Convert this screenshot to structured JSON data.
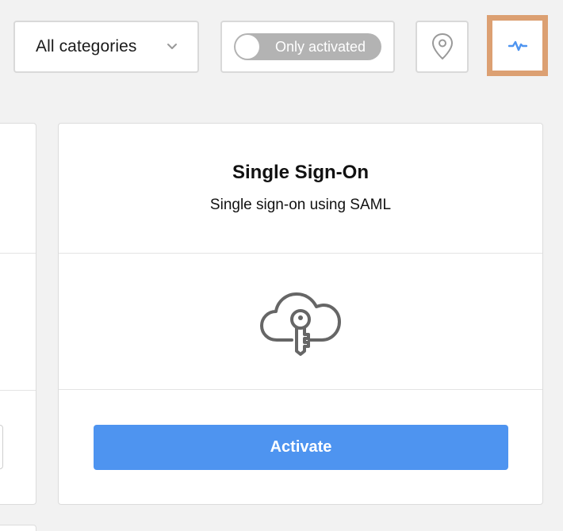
{
  "toolbar": {
    "category_select": {
      "value": "All categories"
    },
    "activation_toggle": {
      "label": "Only activated",
      "on": false
    },
    "location_button_icon": "map-pin-icon",
    "activity_button_icon": "activity-pulse-icon"
  },
  "card": {
    "title": "Single Sign-On",
    "subtitle": "Single sign-on using SAML",
    "icon": "cloud-key-icon",
    "action_label": "Activate"
  },
  "colors": {
    "primary": "#4e94f0",
    "toggle_off": "#b3b3b3",
    "focus_outline": "#dca072",
    "icon_gray": "#666666"
  }
}
